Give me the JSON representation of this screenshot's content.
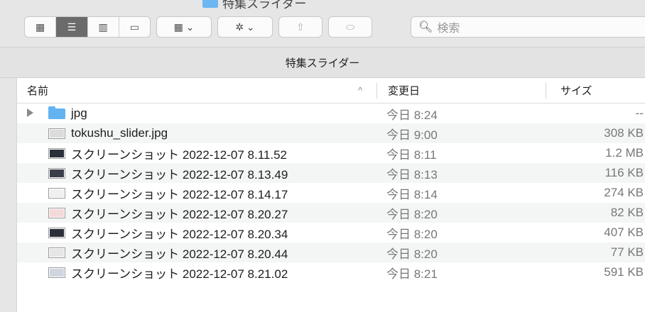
{
  "window": {
    "title": "特集スライダー"
  },
  "toolbar": {
    "view_buttons": [
      {
        "name": "icon-view",
        "icon": "grid-icon",
        "glyph": "▦",
        "active": false
      },
      {
        "name": "list-view",
        "icon": "list-icon",
        "glyph": "☰",
        "active": true
      },
      {
        "name": "column-view",
        "icon": "columns-icon",
        "glyph": "▥",
        "active": false
      },
      {
        "name": "gallery-view",
        "icon": "gallery-icon",
        "glyph": "▭",
        "active": false
      }
    ],
    "group_glyph": "▦ ⌄",
    "action_glyph": "✲ ⌄",
    "share_glyph": "⇧",
    "tag_glyph": "⬭",
    "search_icon": "🔍︎",
    "search_placeholder": "検索"
  },
  "columns": {
    "name": "名前",
    "sort_indicator": "^",
    "date": "変更日",
    "size": "サイズ"
  },
  "files": [
    {
      "name": "jpg",
      "date": "今日 8:24",
      "size": "--",
      "kind": "folder",
      "thumb": ""
    },
    {
      "name": "tokushu_slider.jpg",
      "date": "今日 9:00",
      "size": "308 KB",
      "kind": "image",
      "thumb": "#dcdcdc"
    },
    {
      "name": "スクリーンショット 2022-12-07 8.11.52",
      "date": "今日 8:11",
      "size": "1.2 MB",
      "kind": "image",
      "thumb": "#2b2f3a"
    },
    {
      "name": "スクリーンショット 2022-12-07 8.13.49",
      "date": "今日 8:13",
      "size": "116 KB",
      "kind": "image",
      "thumb": "#3a3f4a"
    },
    {
      "name": "スクリーンショット 2022-12-07 8.14.17",
      "date": "今日 8:14",
      "size": "274 KB",
      "kind": "image",
      "thumb": "#f0f0f0"
    },
    {
      "name": "スクリーンショット 2022-12-07 8.20.27",
      "date": "今日 8:20",
      "size": "82 KB",
      "kind": "image",
      "thumb": "#f4d9d9"
    },
    {
      "name": "スクリーンショット 2022-12-07 8.20.34",
      "date": "今日 8:20",
      "size": "407 KB",
      "kind": "image",
      "thumb": "#2b2f3a"
    },
    {
      "name": "スクリーンショット 2022-12-07 8.20.44",
      "date": "今日 8:20",
      "size": "77 KB",
      "kind": "image",
      "thumb": "#e6e6e6"
    },
    {
      "name": "スクリーンショット 2022-12-07 8.21.02",
      "date": "今日 8:21",
      "size": "591 KB",
      "kind": "image",
      "thumb": "#cfd6e0"
    }
  ]
}
